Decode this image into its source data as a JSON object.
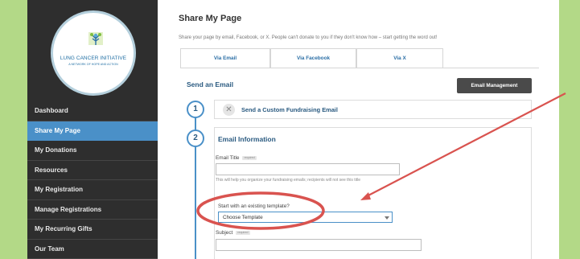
{
  "sidebar": {
    "logo": {
      "name": "LUNG CANCER INITIATIVE",
      "tagline": "A NETWORK OF HOPE AND ACTION"
    },
    "items": [
      {
        "label": "Dashboard"
      },
      {
        "label": "Share My Page"
      },
      {
        "label": "My Donations"
      },
      {
        "label": "Resources"
      },
      {
        "label": "My Registration"
      },
      {
        "label": "Manage Registrations"
      },
      {
        "label": "My Recurring Gifts"
      },
      {
        "label": "Our Team"
      }
    ],
    "active_item": "Share My Page"
  },
  "main": {
    "title": "Share My Page",
    "subtitle": "Share your page by email, Facebook, or X. People can't donate to you if they don't know how – start getting the word out!",
    "tabs": [
      {
        "label": "Via Email"
      },
      {
        "label": "Via Facebook"
      },
      {
        "label": "Via X"
      }
    ],
    "active_tab": "Via Email",
    "section_title": "Send an Email",
    "email_management_button": "Email Management",
    "steps": [
      {
        "number": "1",
        "label": "Send a Custom Fundraising Email"
      },
      {
        "number": "2",
        "label": "Email Information"
      }
    ],
    "form": {
      "email_title_label": "Email Title",
      "required_badge": "required",
      "email_title_value": "",
      "email_title_help": "This will help you organize your fundraising emails; recipients will not see this title",
      "template_label": "Start with an existing template?",
      "template_value": "Choose Template",
      "subject_label": "Subject",
      "subject_value": ""
    }
  },
  "colors": {
    "frame": "#b3d987",
    "sidebar": "#2e2e2e",
    "active_nav": "#4a90c8",
    "accent": "#2a5a80",
    "annotation": "#d9534f"
  }
}
